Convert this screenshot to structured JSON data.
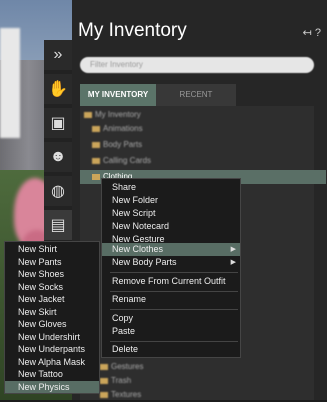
{
  "panel": {
    "title": "My Inventory",
    "header_icons": "↤ ?",
    "search_placeholder": "Filter Inventory",
    "tabs": [
      {
        "label": "MY INVENTORY"
      },
      {
        "label": "RECENT"
      }
    ]
  },
  "toolbar": {
    "icons": [
      "chevrons-right-icon",
      "hand-icon",
      "contact-card-icon",
      "people-icon",
      "globe-icon",
      "suitcase-icon"
    ]
  },
  "tree": {
    "rows": [
      {
        "label": "My Inventory"
      },
      {
        "label": "Animations"
      },
      {
        "label": "Body Parts"
      },
      {
        "label": "Calling Cards"
      },
      {
        "label": "Clothing"
      },
      {
        "label": "Gestures"
      },
      {
        "label": "Trash"
      },
      {
        "label": "Textures"
      }
    ]
  },
  "context_menu": {
    "items": [
      {
        "label": "Share"
      },
      {
        "label": "New Folder"
      },
      {
        "label": "New Script"
      },
      {
        "label": "New Notecard"
      },
      {
        "label": "New Gesture"
      },
      {
        "label": "New Clothes"
      },
      {
        "label": "New Body Parts"
      },
      {
        "label": "Remove From Current Outfit"
      },
      {
        "label": "Rename"
      },
      {
        "label": "Copy"
      },
      {
        "label": "Paste"
      },
      {
        "label": "Delete"
      }
    ]
  },
  "submenu": {
    "items": [
      {
        "label": "New Shirt"
      },
      {
        "label": "New Pants"
      },
      {
        "label": "New Shoes"
      },
      {
        "label": "New Socks"
      },
      {
        "label": "New Jacket"
      },
      {
        "label": "New Skirt"
      },
      {
        "label": "New Gloves"
      },
      {
        "label": "New Undershirt"
      },
      {
        "label": "New Underpants"
      },
      {
        "label": "New Alpha Mask"
      },
      {
        "label": "New Tattoo"
      },
      {
        "label": "New Physics"
      }
    ]
  },
  "colors": {
    "accent": "#586d64",
    "tab_active": "#5b7469"
  }
}
